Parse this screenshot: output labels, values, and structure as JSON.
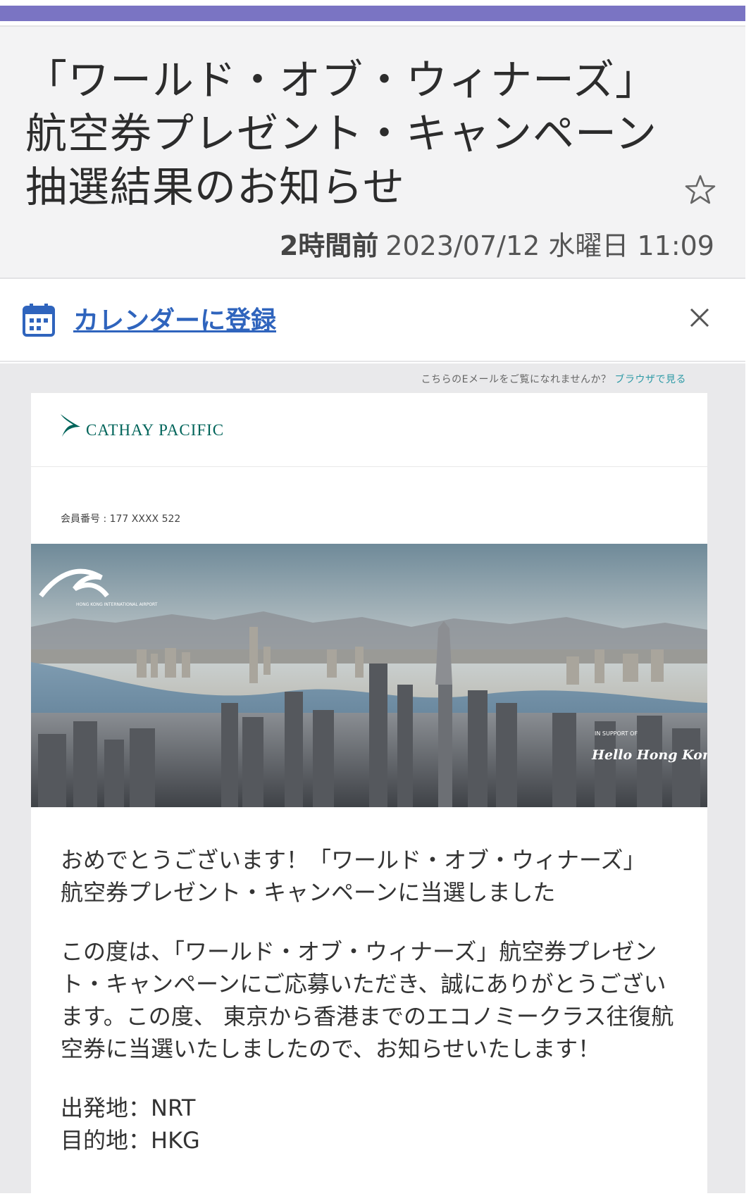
{
  "header": {
    "subject_lines": [
      "「ワールド・オブ・ウィナーズ」",
      "航空券プレゼント・キャンペーン",
      "抽選結果のお知らせ"
    ],
    "relative_time": "2時間前",
    "datetime": "2023/07/12 水曜日 11:09",
    "star_icon": "star-outline-icon"
  },
  "calendar": {
    "link_label": "カレンダーに登録",
    "icon": "calendar-icon",
    "close_icon": "close-icon"
  },
  "email": {
    "preheader_text": "こちらのEメールをご覧になれませんか？",
    "preheader_link": "ブラウザで見る",
    "brand": "CATHAY PACIFIC",
    "member_number": "会員番号 : 177 XXXX 522",
    "hero_badge_small": "IN SUPPORT OF",
    "hero_badge_main": "Hello Hong Kong",
    "hero_airport_label": "HONG KONG INTERNATIONAL AIRPORT",
    "congrats_line1": "おめでとうございます！「ワールド・オブ・ウィナーズ」",
    "congrats_line2": "航空券プレゼント・キャンペーンに当選しました",
    "body_paragraph": "この度は、「ワールド・オブ・ウィナーズ」航空券プレゼント・キャンペーンにご応募いただき、誠にありがとうございます。この度、 東京から香港までのエコノミークラス往復航空券に当選いたしましたので、お知らせいたします！",
    "departure": "出発地：NRT",
    "destination": "目的地：HKG"
  },
  "colors": {
    "accent_bar": "#7a74c3",
    "link": "#2f64bd",
    "brand_green": "#00645a"
  }
}
